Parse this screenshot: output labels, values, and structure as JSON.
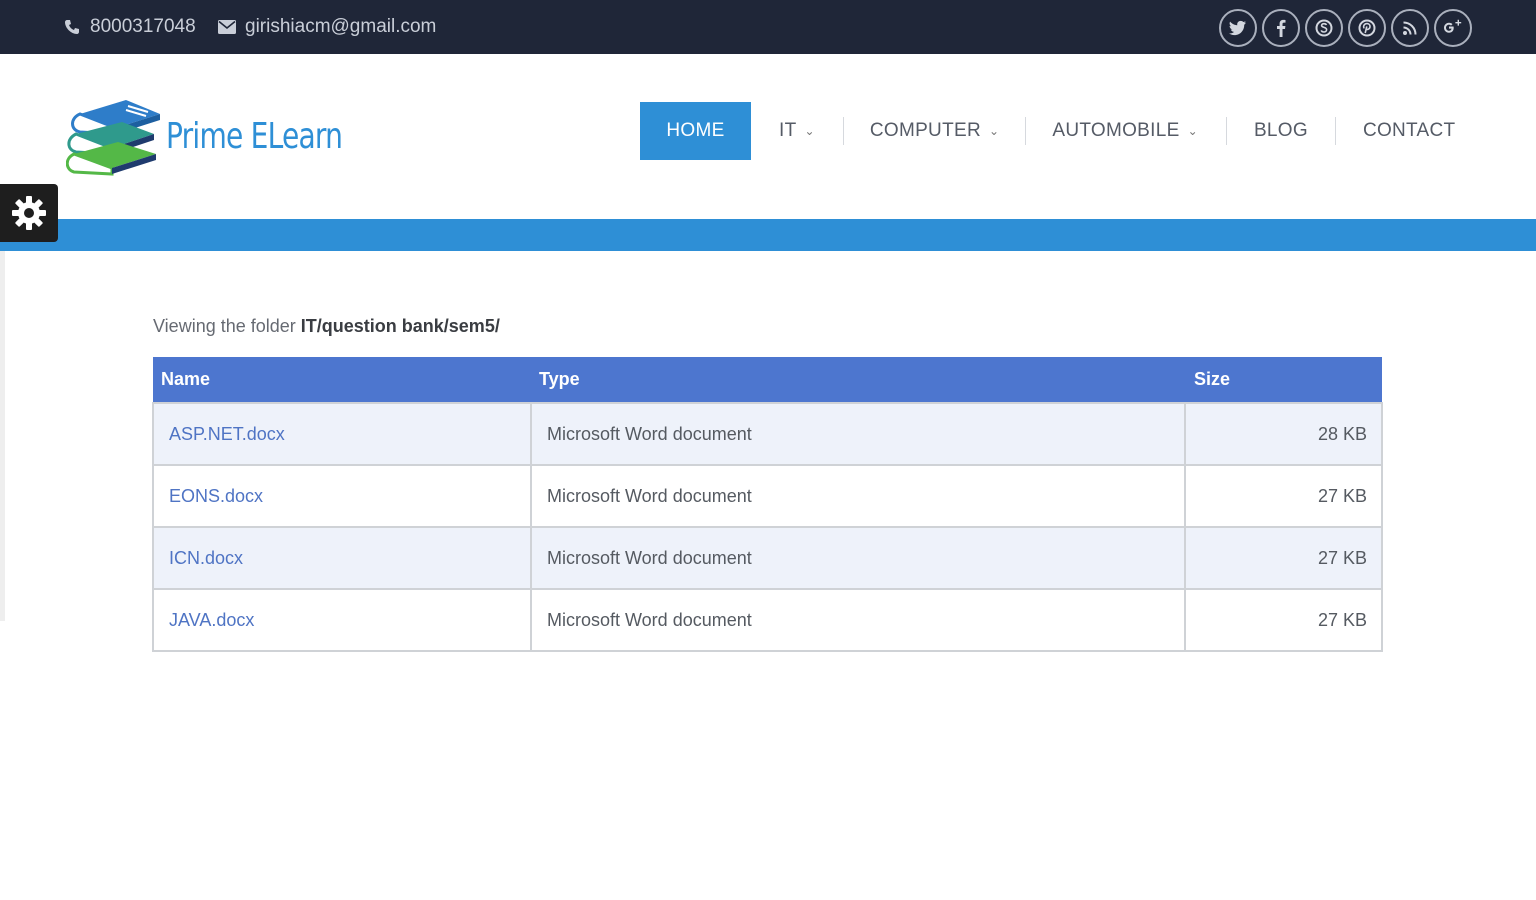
{
  "topbar": {
    "phone": "8000317048",
    "email": "girishiacm@gmail.com",
    "social_icons": [
      "twitter-icon",
      "facebook-icon",
      "skype-icon",
      "pinterest-icon",
      "rss-icon",
      "google-plus-icon"
    ]
  },
  "logo": {
    "text": "Prime ELearn"
  },
  "nav": {
    "home": "HOME",
    "it": "IT",
    "computer": "COMPUTER",
    "automobile": "AUTOMOBILE",
    "blog": "BLOG",
    "contact": "CONTACT"
  },
  "viewing": {
    "prefix": "Viewing the folder",
    "path": "IT/question bank/sem5/"
  },
  "table": {
    "headers": {
      "name": "Name",
      "type": "Type",
      "size": "Size"
    },
    "rows": [
      {
        "name": "ASP.NET.docx",
        "type": "Microsoft Word document",
        "size": "28 KB"
      },
      {
        "name": "EONS.docx",
        "type": "Microsoft Word document",
        "size": "27 KB"
      },
      {
        "name": "ICN.docx",
        "type": "Microsoft Word document",
        "size": "27 KB"
      },
      {
        "name": "JAVA.docx",
        "type": "Microsoft Word document",
        "size": "27 KB"
      }
    ]
  },
  "colors": {
    "topbar": "#1f2638",
    "accent": "#2e8fd6",
    "table_header": "#4d76cf"
  }
}
